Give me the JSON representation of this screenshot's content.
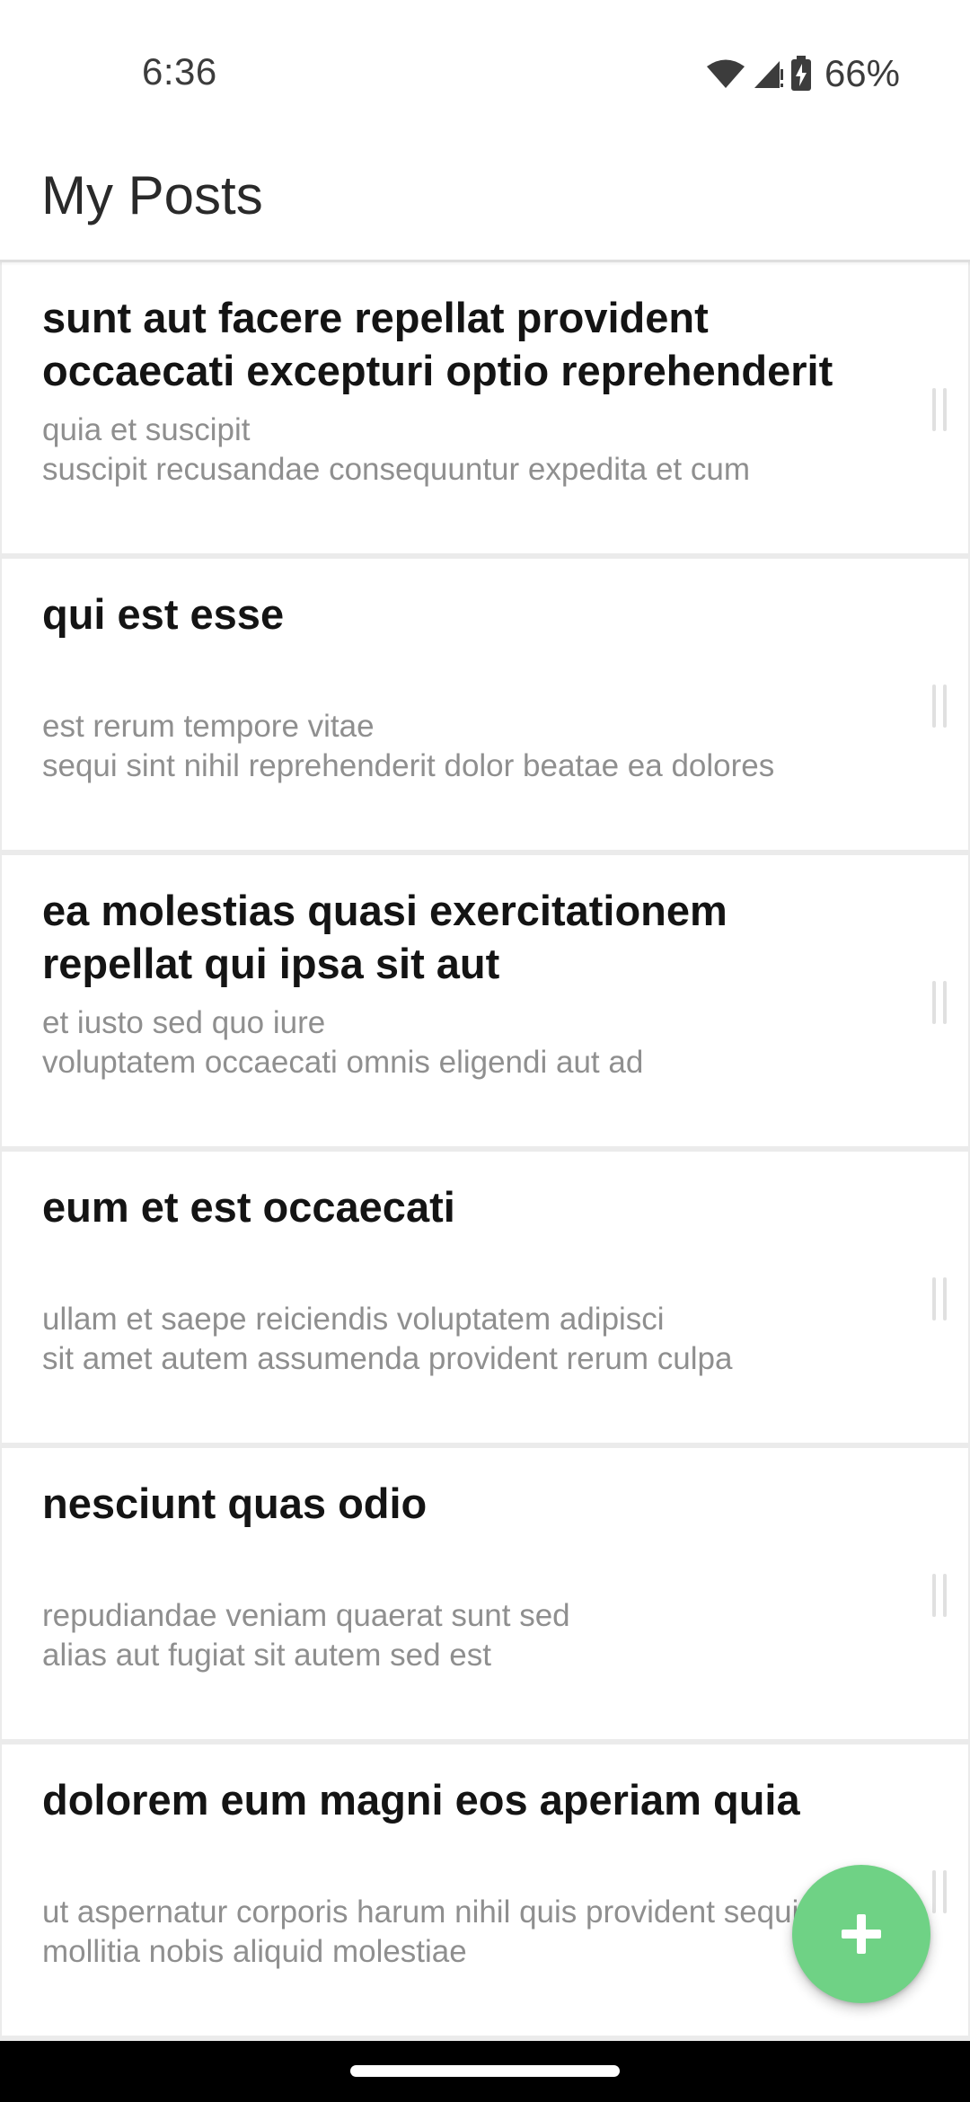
{
  "status_bar": {
    "time": "6:36",
    "battery_text": "66%",
    "icons": [
      "wifi-icon",
      "cell-signal-icon",
      "battery-charging-icon"
    ]
  },
  "app_bar": {
    "title": "My Posts"
  },
  "posts": [
    {
      "title": "sunt aut facere repellat provident occaecati excepturi optio reprehenderit",
      "body": "quia et suscipit\nsuscipit recusandae consequuntur expedita et cum"
    },
    {
      "title": "qui est esse",
      "body": "est rerum tempore vitae\nsequi sint nihil reprehenderit dolor beatae ea dolores"
    },
    {
      "title": "ea molestias quasi exercitationem repellat qui ipsa sit aut",
      "body": "et iusto sed quo iure\nvoluptatem occaecati omnis eligendi aut ad"
    },
    {
      "title": "eum et est occaecati",
      "body": "ullam et saepe reiciendis voluptatem adipisci\nsit amet autem assumenda provident rerum culpa"
    },
    {
      "title": "nesciunt quas odio",
      "body": "repudiandae veniam quaerat sunt sed\nalias aut fugiat sit autem sed est"
    },
    {
      "title": "dolorem eum magni eos aperiam quia",
      "body": "ut aspernatur corporis harum nihil quis provident sequi\nmollitia nobis aliquid molestiae"
    }
  ],
  "fab": {
    "icon": "plus-icon",
    "color": "#6fd285"
  },
  "colors": {
    "title_text": "#141414",
    "body_text": "#8f8f8f",
    "list_background": "#ebebeb"
  }
}
